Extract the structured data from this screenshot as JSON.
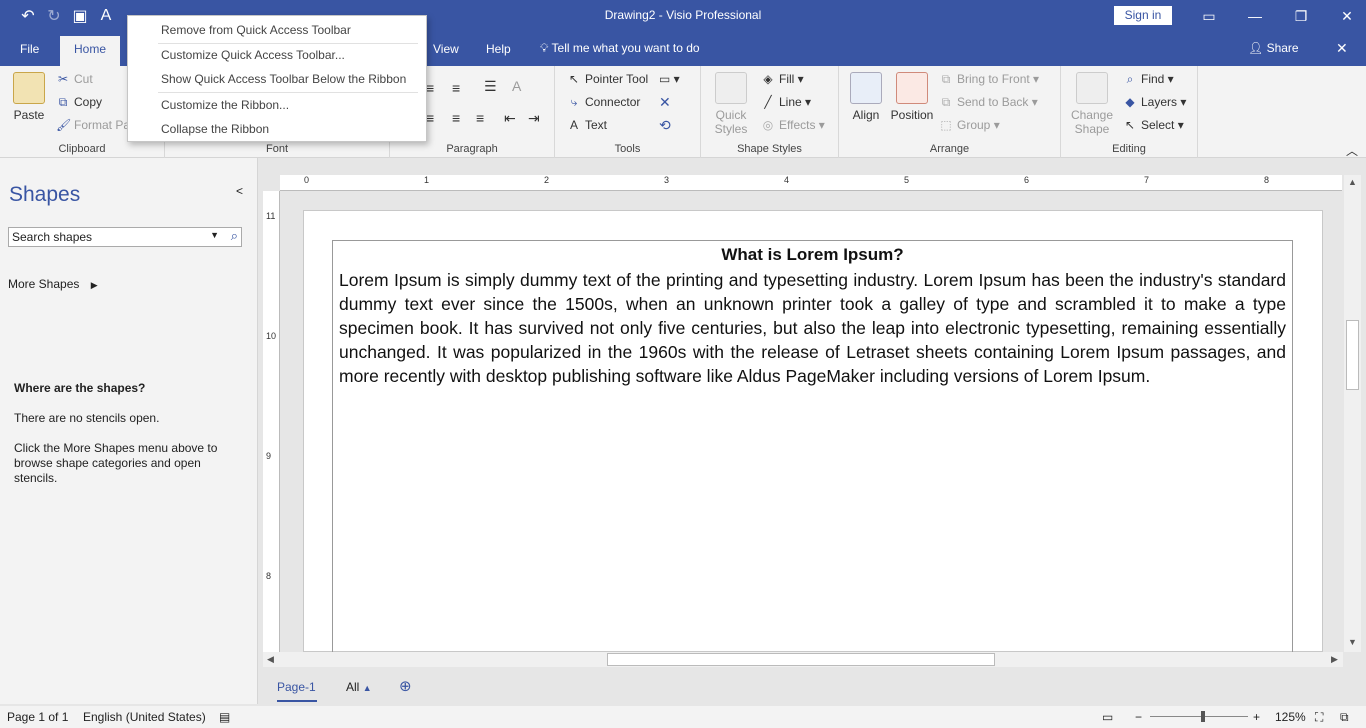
{
  "window": {
    "title": "Drawing2  -  Visio Professional",
    "sign_in": "Sign in"
  },
  "tabs": {
    "file": "File",
    "home": "Home",
    "view": "View",
    "help": "Help",
    "tell_me": "Tell me what you want to do",
    "share": "Share"
  },
  "context_menu": {
    "items": [
      "Remove from Quick Access Toolbar",
      "Customize Quick Access Toolbar...",
      "Show Quick Access Toolbar Below the Ribbon",
      "Customize the Ribbon...",
      "Collapse the Ribbon"
    ]
  },
  "ribbon": {
    "clipboard": {
      "label": "Clipboard",
      "paste": "Paste",
      "cut": "Cut",
      "copy": "Copy",
      "format_painter": "Format Pa"
    },
    "font": {
      "label": "Font"
    },
    "paragraph": {
      "label": "Paragraph"
    },
    "tools": {
      "label": "Tools",
      "pointer": "Pointer Tool",
      "connector": "Connector",
      "text": "Text"
    },
    "shape_styles": {
      "label": "Shape Styles",
      "quick": "Quick",
      "styles": "Styles",
      "fill": "Fill",
      "line": "Line",
      "effects": "Effects"
    },
    "arrange": {
      "label": "Arrange",
      "align": "Align",
      "position": "Position",
      "bring_front": "Bring to Front",
      "send_back": "Send to Back",
      "group": "Group"
    },
    "editing": {
      "label": "Editing",
      "change": "Change",
      "shape": "Shape",
      "find": "Find",
      "layers": "Layers",
      "select": "Select"
    }
  },
  "shapes_pane": {
    "title": "Shapes",
    "search_placeholder": "Search shapes",
    "more_shapes": "More Shapes",
    "where_title": "Where are the shapes?",
    "no_stencils": "There are no stencils open.",
    "hint": "Click the More Shapes menu above to browse shape categories and open stencils."
  },
  "rulers": {
    "h": [
      "0",
      "1",
      "2",
      "3",
      "4",
      "5",
      "6",
      "7",
      "8"
    ],
    "v": [
      "11",
      "10",
      "9",
      "8"
    ]
  },
  "document": {
    "title": "What is Lorem Ipsum?",
    "body": "Lorem Ipsum is simply dummy text of the printing and typesetting industry. Lorem Ipsum has been the industry's standard dummy text ever since the 1500s, when an unknown printer took a galley of type and scrambled it to make a type specimen book. It has survived not only five centuries, but also the leap into electronic typesetting, remaining essentially unchanged. It was popularized in the 1960s with the release of Letraset sheets containing Lorem Ipsum passages, and more recently with desktop publishing software like Aldus PageMaker including versions of Lorem Ipsum."
  },
  "page_tabs": {
    "page1": "Page-1",
    "all": "All"
  },
  "status": {
    "page": "Page 1 of 1",
    "language": "English (United States)",
    "zoom": "125%"
  }
}
